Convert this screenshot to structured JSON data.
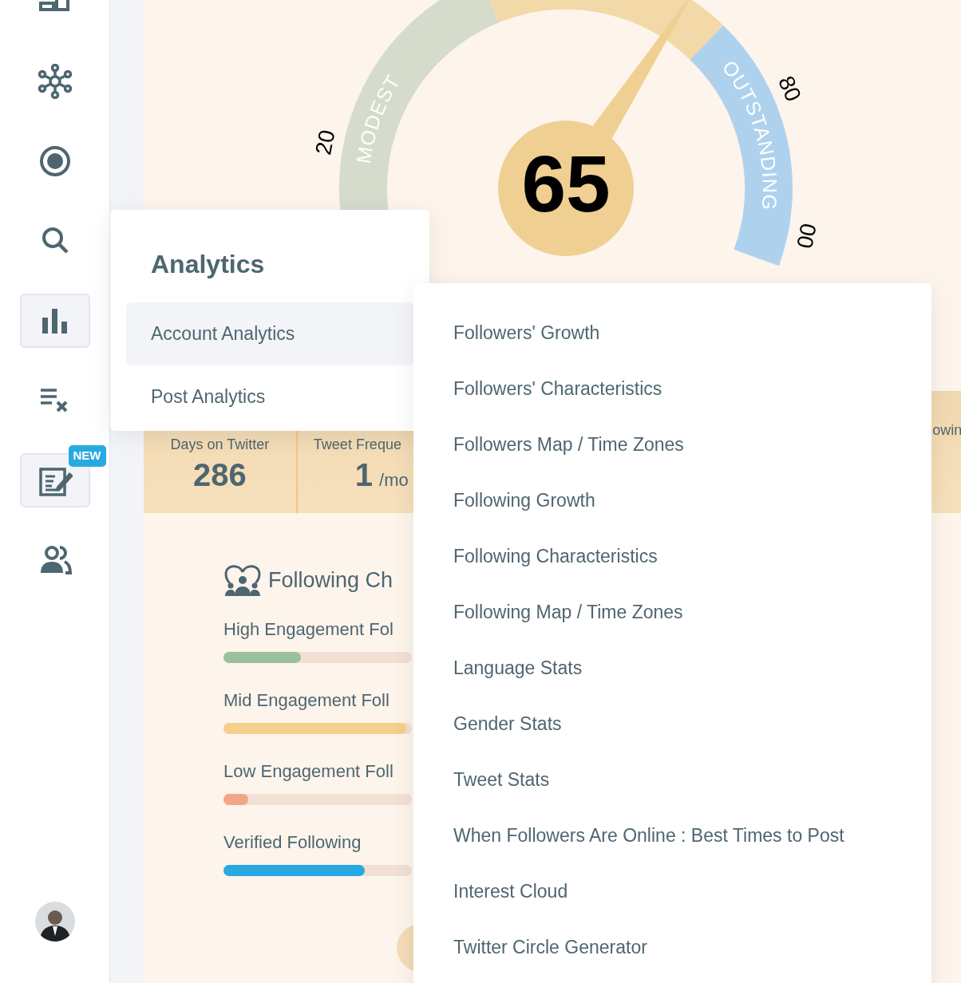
{
  "sidebar": {
    "items": [
      {
        "kind": "dashboard",
        "highlighted": false
      },
      {
        "kind": "network",
        "highlighted": false
      },
      {
        "kind": "record",
        "highlighted": false
      },
      {
        "kind": "search",
        "highlighted": false
      },
      {
        "kind": "chart",
        "highlighted": true
      },
      {
        "kind": "clear-list",
        "highlighted": false
      },
      {
        "kind": "compose",
        "highlighted": true,
        "badge": "NEW"
      },
      {
        "kind": "people",
        "highlighted": false
      }
    ]
  },
  "gauge": {
    "score": "65",
    "level": 0.65,
    "zones": [
      {
        "label": "MODEST",
        "color": "#d5dccc"
      },
      {
        "color": "#f3d9a8"
      },
      {
        "label": "OUTSTANDING",
        "color": "#aed2ee"
      }
    ],
    "ticks": [
      {
        "label": "20"
      },
      {
        "label": "80"
      },
      {
        "label": "00"
      }
    ]
  },
  "stats": [
    {
      "label": "Days on Twitter",
      "value": "286"
    },
    {
      "label": "Tweet Freque",
      "value": "1",
      "unit": "/mo"
    },
    {
      "label": "owin"
    }
  ],
  "following": {
    "title": "Following Ch",
    "bars": [
      {
        "label": "High Engagement Fol",
        "level": 0.41,
        "color": "#99c19e"
      },
      {
        "label": "Mid Engagement Foll",
        "level": 0.97,
        "color": "#f5cf8c"
      },
      {
        "label": "Low Engagement Foll",
        "level": 0.13,
        "color": "#f1a686"
      },
      {
        "label": "Verified Following",
        "level": 0.75,
        "color": "#29a9e1"
      }
    ]
  },
  "menu": {
    "title": "Analytics",
    "items": [
      {
        "label": "Account Analytics",
        "selected": true
      },
      {
        "label": "Post Analytics",
        "selected": false
      }
    ]
  },
  "submenu": {
    "items": [
      "Followers' Growth",
      "Followers' Characteristics",
      "Followers Map / Time Zones",
      "Following Growth",
      "Following Characteristics",
      "Following Map / Time Zones",
      "Language Stats",
      "Gender Stats",
      "Tweet Stats",
      "When Followers Are Online : Best Times to Post",
      "Interest Cloud",
      "Twitter Circle Generator"
    ]
  }
}
